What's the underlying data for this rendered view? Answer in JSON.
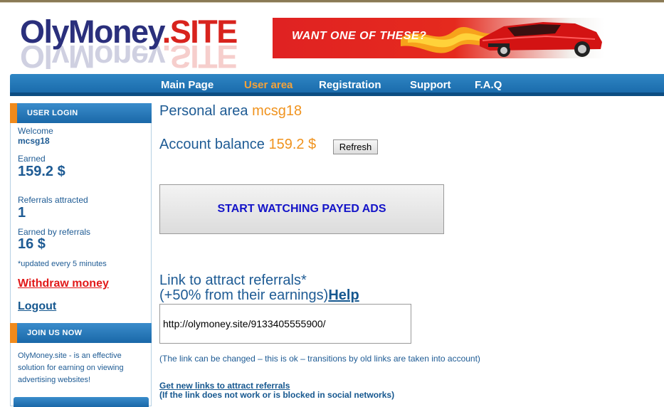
{
  "logo": {
    "name_part": "OlyMoney",
    "dot_part": ".SITE"
  },
  "banner": {
    "text": "WANT ONE OF THESE?"
  },
  "nav": {
    "items": [
      {
        "label": "Main Page",
        "active": false
      },
      {
        "label": "User area",
        "active": true
      },
      {
        "label": "Registration",
        "active": false
      },
      {
        "label": "Support",
        "active": false
      },
      {
        "label": "F.A.Q",
        "active": false
      }
    ]
  },
  "login_panel": {
    "title": "USER LOGIN",
    "welcome_label": "Welcome",
    "username": "mcsg18",
    "earned_label": "Earned",
    "earned_value": "159.2 $",
    "referrals_label": "Referrals attracted",
    "referrals_value": "1",
    "ref_earned_label": "Earned by referrals",
    "ref_earned_value": "16 $",
    "update_note": "*updated every 5 minutes",
    "withdraw_link": "Withdraw money",
    "logout_link": "Logout"
  },
  "join_panel": {
    "title": "JOIN US NOW",
    "description": "OlyMoney.site - is an effective solution for earning on viewing advertising websites!"
  },
  "main": {
    "personal_label": "Personal area",
    "username": "mcsg18",
    "balance_label": "Account balance",
    "balance_value": "159.2 $",
    "refresh_button": "Refresh",
    "watch_button": "START WATCHING PAYED ADS",
    "referral_title_line1": "Link to attract referrals*",
    "referral_title_line2": "(+50% from their earnings)",
    "help_link": "Help",
    "referral_link_value": "http://olymoney.site/9133405555900/",
    "link_note": "(The link can be changed – this is ok – transitions by old links are taken into account)",
    "new_links_link": "Get new links to attract referrals",
    "new_links_note": "(If the link does not work or is blocked in social networks)"
  },
  "colors": {
    "brand_blue": "#2a2f7c",
    "brand_red": "#d8231d",
    "nav_blue": "#1767a7",
    "accent_orange": "#f0931e",
    "text_blue": "#1e5b94"
  }
}
